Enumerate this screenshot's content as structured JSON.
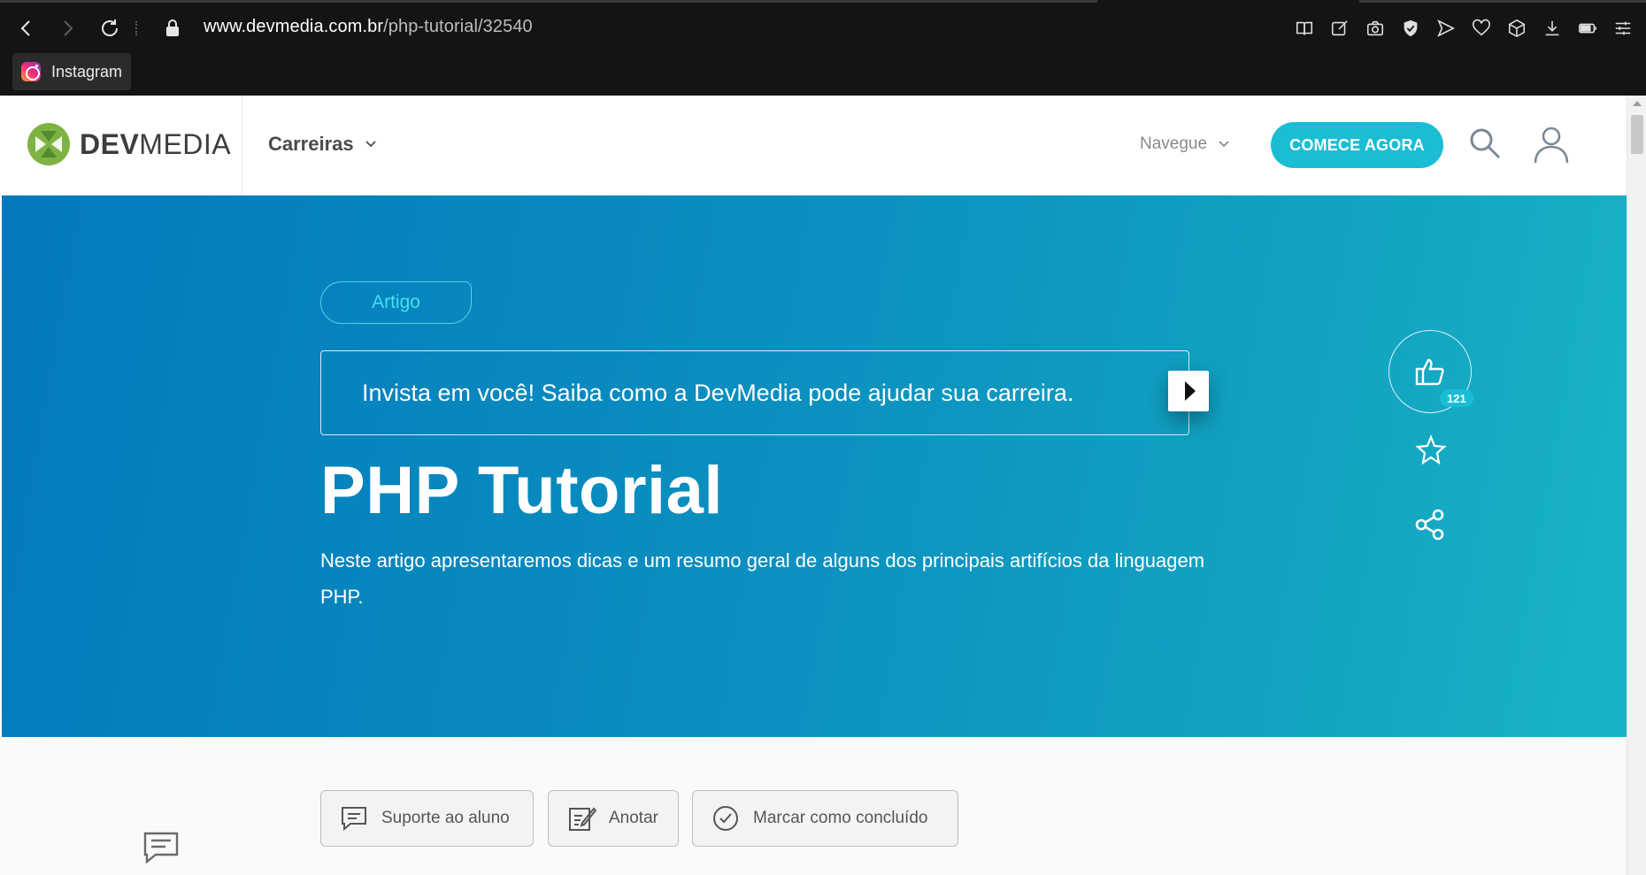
{
  "browser": {
    "url_host": "www.devmedia.com.br",
    "url_path": "/php-tutorial/32540",
    "bookmark_label": "Instagram",
    "icons": [
      "back-icon",
      "forward-icon",
      "reload-icon",
      "lock-icon",
      "reader-icon",
      "edit-icon",
      "camera-icon",
      "shield-icon",
      "send-icon",
      "heart-icon",
      "cube-icon",
      "download-icon",
      "battery-icon",
      "menu-icon"
    ]
  },
  "header": {
    "logo_bold": "DEV",
    "logo_light": "MEDIA",
    "carreiras": "Carreiras",
    "navegue": "Navegue",
    "cta": "COMECE AGORA",
    "brand_color": "#1bbdd4",
    "logo_color": "#7cb342"
  },
  "hero": {
    "badge": "Artigo",
    "promo": "Invista em você! Saiba como a DevMedia pode ajudar sua carreira.",
    "title": "PHP Tutorial",
    "description": "Neste artigo apresentaremos dicas e um resumo geral de alguns dos principais artifícios da linguagem PHP.",
    "likes": "121",
    "gradient_start": "#0479bd",
    "gradient_end": "#19b3c6"
  },
  "actions": {
    "support": "Suporte ao aluno",
    "annotate": "Anotar",
    "complete": "Marcar como concluído"
  }
}
